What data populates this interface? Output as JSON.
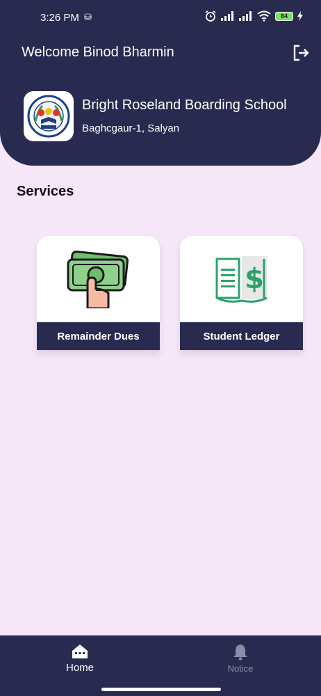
{
  "status_bar": {
    "time": "3:26 PM",
    "sim_icon": "sim-icon",
    "battery": "84",
    "icons": [
      "alarm-icon",
      "signal-icon",
      "signal-icon",
      "wifi-icon",
      "battery-icon",
      "charging-icon"
    ]
  },
  "header": {
    "welcome": "Welcome Binod  Bharmin",
    "logout_icon": "logout-icon",
    "school_name": "Bright Roseland Boarding School",
    "school_address": "Baghcgaur-1, Salyan",
    "logo_icon": "school-logo"
  },
  "services": {
    "title": "Services",
    "items": [
      {
        "label": "Remainder Dues",
        "icon": "money-hand-icon"
      },
      {
        "label": "Student Ledger",
        "icon": "ledger-book-icon"
      }
    ]
  },
  "bottom_nav": {
    "items": [
      {
        "label": "Home",
        "icon": "home-icon",
        "active": true
      },
      {
        "label": "Notice",
        "icon": "bell-icon",
        "active": false
      }
    ]
  },
  "colors": {
    "primary": "#282b4f",
    "background": "#f5e6f8",
    "ledger_green": "#2aa36b",
    "money_green": "#8fd18a"
  }
}
